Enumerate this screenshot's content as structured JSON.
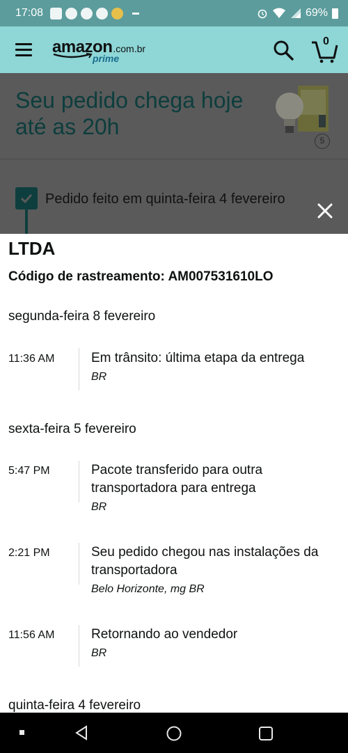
{
  "status_bar": {
    "time": "17:08",
    "battery": "69%"
  },
  "header": {
    "logo_word": "amazon",
    "logo_domain": ".com.br",
    "logo_prime": "prime",
    "cart_count": "0"
  },
  "background": {
    "headline": "Seu pedido chega hoje até as 20h",
    "product_count": "5",
    "order_placed": "Pedido feito em quinta-feira 4 fevereiro"
  },
  "tracking": {
    "carrier": "LTDA",
    "code_line": "Código de rastreamento: AM007531610LO",
    "days": [
      {
        "date": "segunda-feira 8 fevereiro",
        "events": [
          {
            "time": "11:36 AM",
            "title": "Em trânsito: última etapa da entrega",
            "location": "BR"
          }
        ]
      },
      {
        "date": "sexta-feira 5 fevereiro",
        "events": [
          {
            "time": "5:47 PM",
            "title": "Pacote transferido para outra transportadora para entrega",
            "location": "BR"
          },
          {
            "time": "2:21 PM",
            "title": "Seu pedido chegou nas instalações da transportadora",
            "location": "Belo Horizonte, mg BR"
          },
          {
            "time": "11:56 AM",
            "title": "Retornando ao vendedor",
            "location": "BR"
          }
        ]
      },
      {
        "date": "quinta-feira 4 fevereiro",
        "events": []
      }
    ]
  },
  "colors": {
    "status_bar": "#5c9c9c",
    "header": "#8fd6d6",
    "overlay": "#5a5a5a",
    "headline": "#0d3d3d"
  },
  "icons": [
    "menu-icon",
    "search-icon",
    "cart-icon",
    "close-icon",
    "check-icon",
    "back-icon",
    "home-icon",
    "recents-icon",
    "wifi-icon",
    "signal-icon",
    "alarm-icon",
    "battery-icon"
  ]
}
